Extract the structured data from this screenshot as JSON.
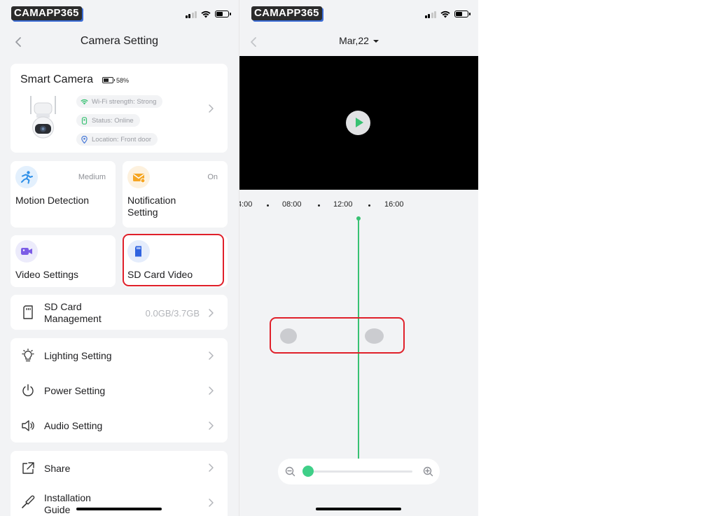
{
  "watermark": "CAMAPP365",
  "left": {
    "title": "Camera Setting",
    "device": {
      "name": "Smart Camera",
      "battery": "58%",
      "wifi": "Wi-Fi strength: Strong",
      "status": "Status: Online",
      "location": "Location: Front door"
    },
    "tiles": [
      {
        "label": "Motion Detection",
        "value": "Medium",
        "icon": "running-person-icon"
      },
      {
        "label": "Notification Setting",
        "value": "On",
        "icon": "envelope-icon"
      },
      {
        "label": "Video Settings",
        "value": "",
        "icon": "video-camera-icon"
      },
      {
        "label": "SD Card Video",
        "value": "",
        "icon": "sd-card-icon"
      }
    ],
    "sd_card": {
      "label": "SD Card Management",
      "value": "0.0GB/3.7GB"
    },
    "settings": [
      {
        "label": "Lighting Setting",
        "icon": "light-bulb-icon"
      },
      {
        "label": "Power Setting",
        "icon": "power-icon"
      },
      {
        "label": "Audio Setting",
        "icon": "speaker-icon"
      }
    ],
    "extras": [
      {
        "label": "Share",
        "icon": "share-icon"
      },
      {
        "label": "Installation Guide",
        "icon": "screwdriver-icon"
      }
    ]
  },
  "right": {
    "date": "Mar,22",
    "ticks": [
      "4:00",
      "08:00",
      "12:00",
      "16:00"
    ]
  },
  "colors": {
    "accent_green": "#38c172",
    "highlight_red": "#e0202a",
    "background": "#f2f3f5"
  }
}
